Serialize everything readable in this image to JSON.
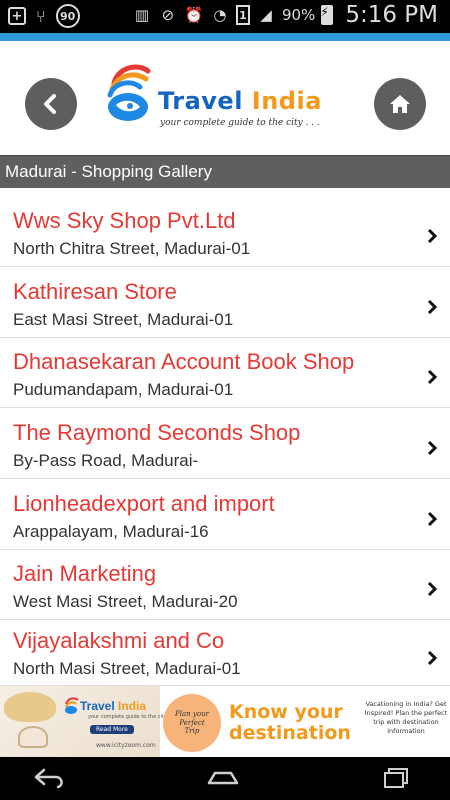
{
  "status_bar": {
    "notification_circle": "90",
    "sim_label": "1",
    "battery_percent": "90%",
    "time": "5:16 PM"
  },
  "header": {
    "logo_title_main": "Travel ",
    "logo_title_accent": "India",
    "logo_tagline": "your complete guide to the city . . .",
    "accent_color": "#2e9ad6"
  },
  "section": {
    "title": "Madurai - Shopping Gallery"
  },
  "shops": [
    {
      "name": "Wws Sky Shop Pvt.Ltd",
      "address": "North Chitra Street, Madurai-01"
    },
    {
      "name": "Kathiresan Store",
      "address": "East Masi Street, Madurai-01"
    },
    {
      "name": "Dhanasekaran Account Book Shop",
      "address": "Pudumandapam, Madurai-01"
    },
    {
      "name": "The Raymond Seconds Shop",
      "address": "By-Pass Road, Madurai-"
    },
    {
      "name": "Lionheadexport and import",
      "address": "Arappalayam, Madurai-16"
    },
    {
      "name": "Jain Marketing",
      "address": "West Masi Street, Madurai-20"
    },
    {
      "name": "Vijayalakshmi and Co",
      "address": "North Masi Street, Madurai-01"
    }
  ],
  "ad": {
    "logo_main": "Travel ",
    "logo_accent": "India",
    "tagline": "your complete guide to the city",
    "read_more": "Read More",
    "url": "www.icityzoom.com",
    "circle_text": "Plan your\nPerfect\nTrip",
    "headline": "Know your\ndestination",
    "small_text": "Vacationing in India? Get Inspired! Plan the perfect trip with destination information"
  },
  "colors": {
    "item_name": "#e53935",
    "section_bar": "#5f5f5f",
    "round_button": "#5e5e5e"
  }
}
